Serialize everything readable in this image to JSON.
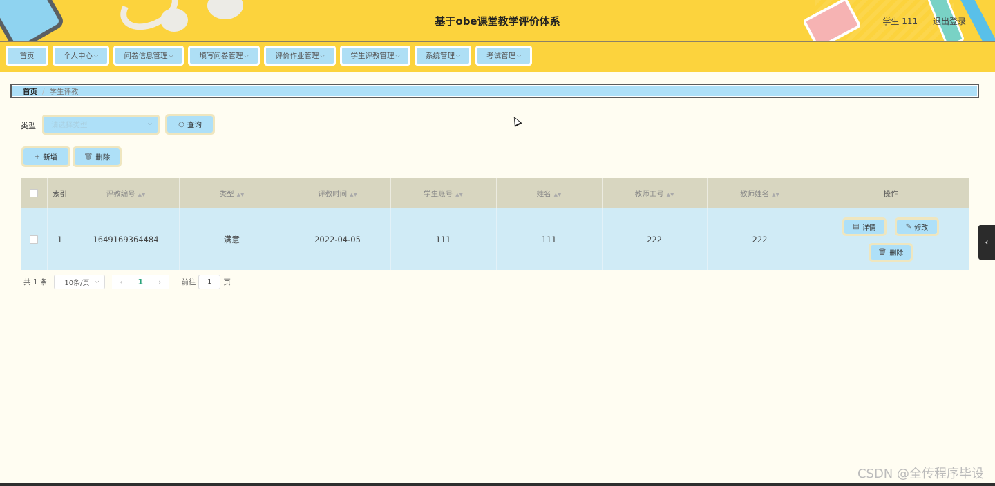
{
  "header": {
    "title": "基于obe课堂教学评价体系",
    "user_label": "学生 111",
    "logout_label": "退出登录"
  },
  "nav": {
    "items": [
      {
        "label": "首页",
        "dropdown": false
      },
      {
        "label": "个人中心",
        "dropdown": true
      },
      {
        "label": "问卷信息管理",
        "dropdown": true
      },
      {
        "label": "填写问卷管理",
        "dropdown": true
      },
      {
        "label": "评价作业管理",
        "dropdown": true
      },
      {
        "label": "学生评教管理",
        "dropdown": true
      },
      {
        "label": "系统管理",
        "dropdown": true
      },
      {
        "label": "考试管理",
        "dropdown": true
      }
    ]
  },
  "breadcrumb": {
    "home": "首页",
    "separator": "/",
    "current": "学生评教"
  },
  "search": {
    "type_label": "类型",
    "type_placeholder": "请选择类型",
    "query_label": "查询"
  },
  "actions": {
    "add_label": "新增",
    "delete_label": "删除"
  },
  "table": {
    "headers": {
      "index": "索引",
      "eval_no": "评教编号",
      "type": "类型",
      "eval_time": "评教时间",
      "student_account": "学生账号",
      "name": "姓名",
      "teacher_no": "教师工号",
      "teacher_name": "教师姓名",
      "actions": "操作"
    },
    "rows": [
      {
        "index": "1",
        "eval_no": "1649169364484",
        "type": "满意",
        "eval_time": "2022-04-05",
        "student_account": "111",
        "name": "111",
        "teacher_no": "222",
        "teacher_name": "222",
        "detail_label": "详情",
        "edit_label": "修改",
        "delete_label": "删除"
      }
    ]
  },
  "pagination": {
    "total_text": "共 1 条",
    "page_size": "10条/页",
    "current_page": "1",
    "goto_label": "前往",
    "goto_value": "1",
    "page_unit": "页"
  },
  "watermark": "CSDN @全传程序毕设",
  "colors": {
    "header_bg": "#fcd33d",
    "page_bg": "#fffdf2",
    "button_bg": "#aee0f8",
    "table_header_bg": "#d8d6c0",
    "row_bg": "#d0ebf6",
    "active_page": "#2aa37a"
  }
}
